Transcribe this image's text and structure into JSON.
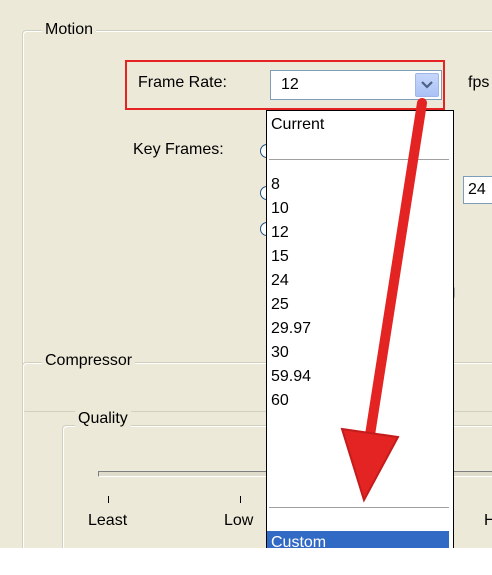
{
  "motion": {
    "group_title": "Motion",
    "frame_rate_label": "Frame Rate:",
    "frame_rate_value": "12",
    "fps_label": "fps",
    "key_frames_label": "Key Frames:",
    "key_frames_value": "24",
    "partial_text": "g"
  },
  "frame_rate_dropdown": {
    "options": [
      "Current",
      "8",
      "10",
      "12",
      "15",
      "24",
      "25",
      "29.97",
      "30",
      "59.94",
      "60",
      "Custom"
    ],
    "selected": "Custom"
  },
  "compressor": {
    "group_title": "Compressor",
    "quality_title": "Quality",
    "slider_labels": [
      "Least",
      "Low",
      "H"
    ]
  },
  "icons": {
    "dropdown_arrow": "chevron-down-icon",
    "annotation_arrow": "red-arrow-icon"
  },
  "colors": {
    "dialog_bg": "#ece9d8",
    "highlight": "#316ac5",
    "annotation_red": "#e42323",
    "combo_button": "#aac2f5"
  }
}
